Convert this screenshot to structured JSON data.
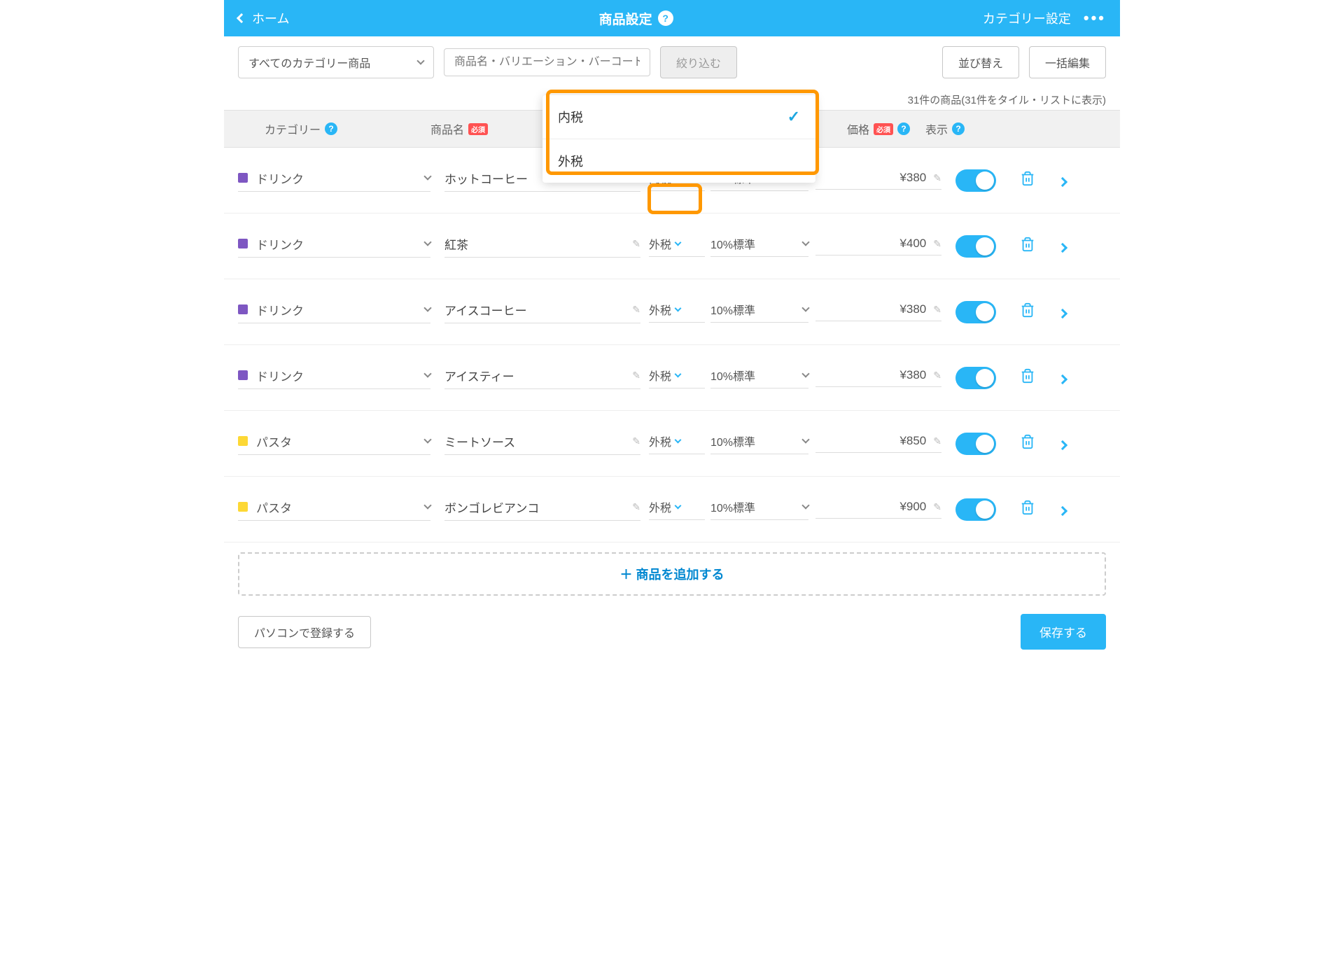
{
  "header": {
    "home": "ホーム",
    "title": "商品設定",
    "category_settings": "カテゴリー設定"
  },
  "toolbar": {
    "category_filter": "すべてのカテゴリー商品",
    "search_placeholder": "商品名・バリエーション・バーコードなど",
    "filter_btn": "絞り込む",
    "sort_btn": "並び替え",
    "bulk_btn": "一括編集"
  },
  "count_text": "31件の商品(31件をタイル・リストに表示)",
  "columns": {
    "category": "カテゴリー",
    "name": "商品名",
    "price": "価格",
    "display": "表示",
    "required": "必須"
  },
  "tax_dropdown": {
    "opt1": "内税",
    "opt2": "外税"
  },
  "rows": [
    {
      "cat": "ドリンク",
      "color": "#7e57c2",
      "name": "ホットコーヒー",
      "tax": "内税",
      "rate": "10%標準",
      "price": "¥380"
    },
    {
      "cat": "ドリンク",
      "color": "#7e57c2",
      "name": "紅茶",
      "tax": "外税",
      "rate": "10%標準",
      "price": "¥400"
    },
    {
      "cat": "ドリンク",
      "color": "#7e57c2",
      "name": "アイスコーヒー",
      "tax": "外税",
      "rate": "10%標準",
      "price": "¥380"
    },
    {
      "cat": "ドリンク",
      "color": "#7e57c2",
      "name": "アイスティー",
      "tax": "外税",
      "rate": "10%標準",
      "price": "¥380"
    },
    {
      "cat": "パスタ",
      "color": "#fdd835",
      "name": "ミートソース",
      "tax": "外税",
      "rate": "10%標準",
      "price": "¥850"
    },
    {
      "cat": "パスタ",
      "color": "#fdd835",
      "name": "ボンゴレビアンコ",
      "tax": "外税",
      "rate": "10%標準",
      "price": "¥900"
    }
  ],
  "add_row": "＋ 商品を追加する",
  "footer": {
    "pc_register": "パソコンで登録する",
    "save": "保存する"
  }
}
